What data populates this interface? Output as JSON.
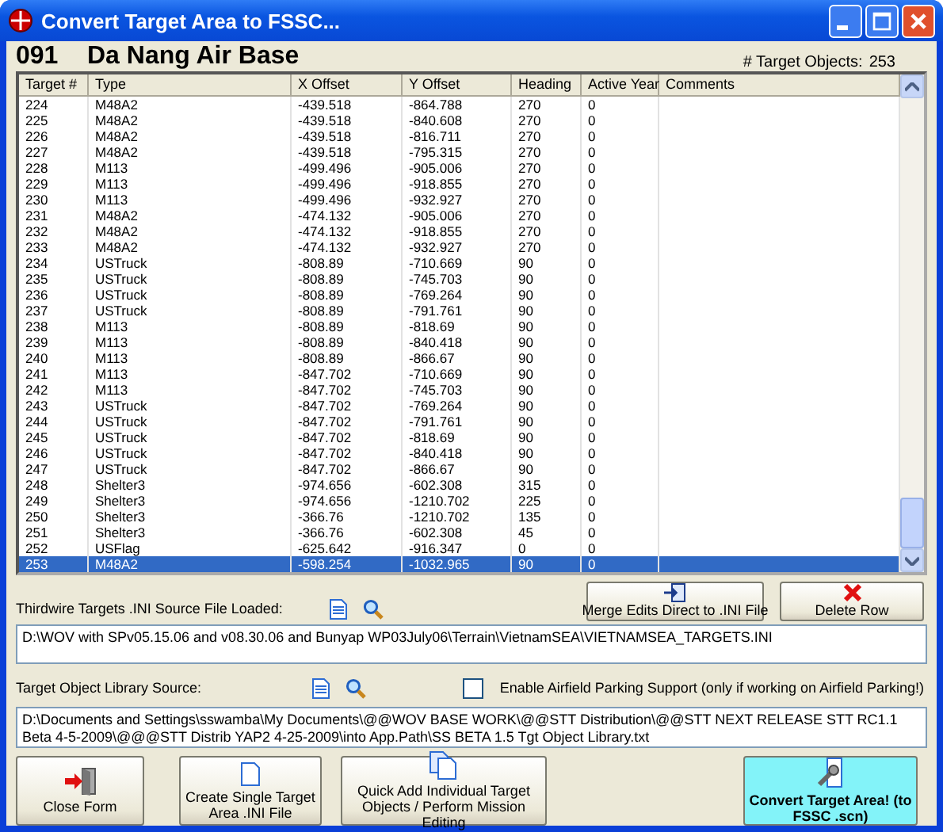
{
  "window": {
    "title": "Convert Target Area to FSSC..."
  },
  "header": {
    "area_number": "091",
    "area_name": "Da Nang Air Base",
    "count_label": "# Target Objects:",
    "count": "253"
  },
  "table": {
    "columns": [
      "Target #",
      "Type",
      "X Offset",
      "Y Offset",
      "Heading",
      "Active Year",
      "Comments"
    ],
    "rows": [
      {
        "cells": [
          "224",
          "M48A2",
          "-439.518",
          "-864.788",
          "270",
          "0"
        ],
        "selected": false
      },
      {
        "cells": [
          "225",
          "M48A2",
          "-439.518",
          "-840.608",
          "270",
          "0"
        ],
        "selected": false
      },
      {
        "cells": [
          "226",
          "M48A2",
          "-439.518",
          "-816.711",
          "270",
          "0"
        ],
        "selected": false
      },
      {
        "cells": [
          "227",
          "M48A2",
          "-439.518",
          "-795.315",
          "270",
          "0"
        ],
        "selected": false
      },
      {
        "cells": [
          "228",
          "M113",
          "-499.496",
          "-905.006",
          "270",
          "0"
        ],
        "selected": false
      },
      {
        "cells": [
          "229",
          "M113",
          "-499.496",
          "-918.855",
          "270",
          "0"
        ],
        "selected": false
      },
      {
        "cells": [
          "230",
          "M113",
          "-499.496",
          "-932.927",
          "270",
          "0"
        ],
        "selected": false
      },
      {
        "cells": [
          "231",
          "M48A2",
          "-474.132",
          "-905.006",
          "270",
          "0"
        ],
        "selected": false
      },
      {
        "cells": [
          "232",
          "M48A2",
          "-474.132",
          "-918.855",
          "270",
          "0"
        ],
        "selected": false
      },
      {
        "cells": [
          "233",
          "M48A2",
          "-474.132",
          "-932.927",
          "270",
          "0"
        ],
        "selected": false
      },
      {
        "cells": [
          "234",
          "USTruck",
          "-808.89",
          "-710.669",
          "90",
          "0"
        ],
        "selected": false
      },
      {
        "cells": [
          "235",
          "USTruck",
          "-808.89",
          "-745.703",
          "90",
          "0"
        ],
        "selected": false
      },
      {
        "cells": [
          "236",
          "USTruck",
          "-808.89",
          "-769.264",
          "90",
          "0"
        ],
        "selected": false
      },
      {
        "cells": [
          "237",
          "USTruck",
          "-808.89",
          "-791.761",
          "90",
          "0"
        ],
        "selected": false
      },
      {
        "cells": [
          "238",
          "M113",
          "-808.89",
          "-818.69",
          "90",
          "0"
        ],
        "selected": false
      },
      {
        "cells": [
          "239",
          "M113",
          "-808.89",
          "-840.418",
          "90",
          "0"
        ],
        "selected": false
      },
      {
        "cells": [
          "240",
          "M113",
          "-808.89",
          "-866.67",
          "90",
          "0"
        ],
        "selected": false
      },
      {
        "cells": [
          "241",
          "M113",
          "-847.702",
          "-710.669",
          "90",
          "0"
        ],
        "selected": false
      },
      {
        "cells": [
          "242",
          "M113",
          "-847.702",
          "-745.703",
          "90",
          "0"
        ],
        "selected": false
      },
      {
        "cells": [
          "243",
          "USTruck",
          "-847.702",
          "-769.264",
          "90",
          "0"
        ],
        "selected": false
      },
      {
        "cells": [
          "244",
          "USTruck",
          "-847.702",
          "-791.761",
          "90",
          "0"
        ],
        "selected": false
      },
      {
        "cells": [
          "245",
          "USTruck",
          "-847.702",
          "-818.69",
          "90",
          "0"
        ],
        "selected": false
      },
      {
        "cells": [
          "246",
          "USTruck",
          "-847.702",
          "-840.418",
          "90",
          "0"
        ],
        "selected": false
      },
      {
        "cells": [
          "247",
          "USTruck",
          "-847.702",
          "-866.67",
          "90",
          "0"
        ],
        "selected": false
      },
      {
        "cells": [
          "248",
          "Shelter3",
          "-974.656",
          "-602.308",
          "315",
          "0"
        ],
        "selected": false
      },
      {
        "cells": [
          "249",
          "Shelter3",
          "-974.656",
          "-1210.702",
          "225",
          "0"
        ],
        "selected": false
      },
      {
        "cells": [
          "250",
          "Shelter3",
          "-366.76",
          "-1210.702",
          "135",
          "0"
        ],
        "selected": false
      },
      {
        "cells": [
          "251",
          "Shelter3",
          "-366.76",
          "-602.308",
          "45",
          "0"
        ],
        "selected": false
      },
      {
        "cells": [
          "252",
          "USFlag",
          "-625.642",
          "-916.347",
          "0",
          "0"
        ],
        "selected": false
      },
      {
        "cells": [
          "253",
          "M48A2",
          "-598.254",
          "-1032.965",
          "90",
          "0"
        ],
        "selected": true
      }
    ]
  },
  "source": {
    "label": "Thirdwire Targets .INI Source File Loaded:",
    "value": "D:\\WOV with SPv05.15.06 and  v08.30.06 and Bunyap WP03July06\\Terrain\\VietnamSEA\\VIETNAMSEA_TARGETS.INI"
  },
  "merge_button": "Merge Edits Direct to .INI File",
  "delete_button": "Delete Row",
  "library": {
    "label": "Target Object Library Source:",
    "value": "D:\\Documents and Settings\\sswamba\\My Documents\\@@WOV BASE WORK\\@@STT Distribution\\@@STT NEXT RELEASE STT RC1.1 Beta 4-5-2009\\@@@STT Distrib YAP2 4-25-2009\\into App.Path\\SS BETA 1.5 Tgt Object Library.txt"
  },
  "parking": {
    "label": "Enable Airfield Parking Support (only if working on Airfield Parking!)",
    "checked": false
  },
  "buttons": [
    {
      "kind": "close",
      "label": "Close Form"
    },
    {
      "kind": "create",
      "label": "Create Single Target Area .INI File"
    },
    {
      "kind": "quick",
      "label": "Quick Add Individual Target Objects / Perform Mission Editing"
    },
    {
      "kind": "convert",
      "label": "Convert Target Area! (to FSSC .scn)"
    }
  ]
}
